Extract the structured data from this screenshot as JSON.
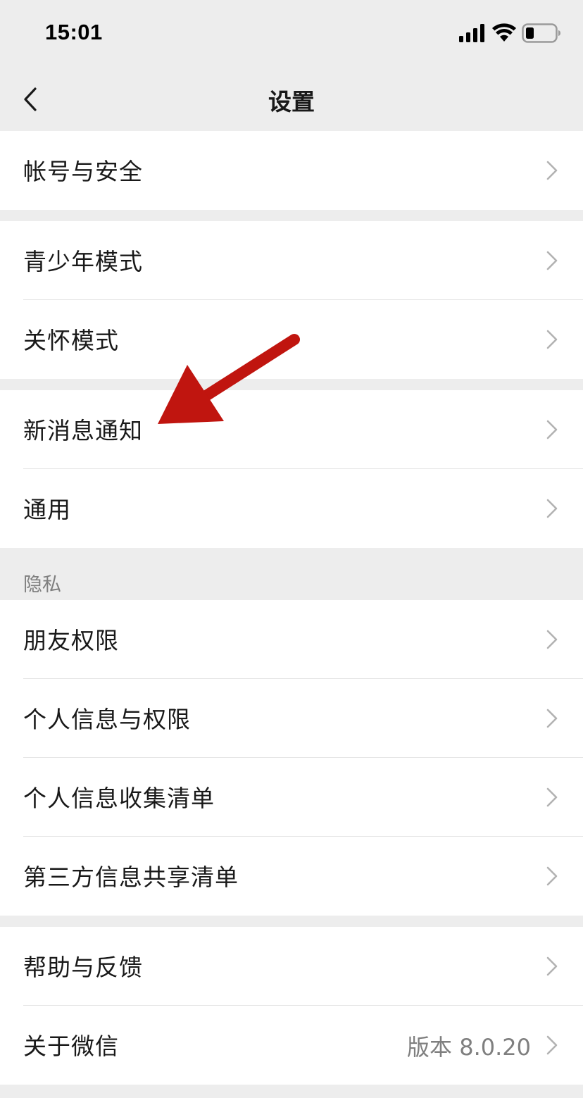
{
  "status_bar": {
    "time": "15:01",
    "icons": [
      "signal-icon",
      "wifi-icon",
      "battery-icon"
    ]
  },
  "nav": {
    "title": "设置",
    "back_icon": "back-chevron-icon"
  },
  "groups": [
    {
      "items": [
        {
          "label": "帐号与安全"
        }
      ]
    },
    {
      "items": [
        {
          "label": "青少年模式"
        },
        {
          "label": "关怀模式"
        }
      ]
    },
    {
      "items": [
        {
          "label": "新消息通知"
        },
        {
          "label": "通用"
        }
      ]
    },
    {
      "header": "隐私",
      "items": [
        {
          "label": "朋友权限"
        },
        {
          "label": "个人信息与权限"
        },
        {
          "label": "个人信息收集清单"
        },
        {
          "label": "第三方信息共享清单"
        }
      ]
    },
    {
      "items": [
        {
          "label": "帮助与反馈"
        },
        {
          "label": "关于微信",
          "value": "版本 8.0.20"
        }
      ]
    }
  ],
  "colors": {
    "background": "#ededed",
    "cell_background": "#ffffff",
    "text": "#191919",
    "secondary_text": "#7f7f7f",
    "annotation_arrow": "#c0150f"
  }
}
